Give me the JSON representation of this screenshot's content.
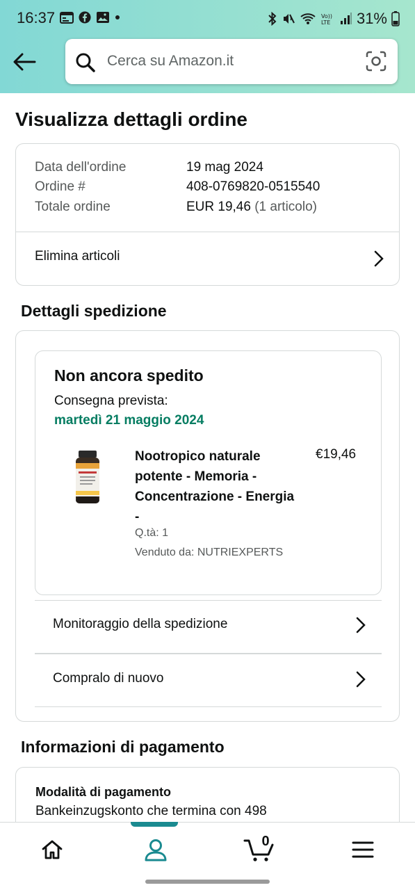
{
  "status_bar": {
    "time": "16:37",
    "battery": "31%",
    "icons": [
      "calendar-icon",
      "facebook-icon",
      "gallery-icon",
      "dot-icon",
      "bluetooth-icon",
      "mute-icon",
      "wifi-icon",
      "volte-icon",
      "signal-icon",
      "battery-icon"
    ]
  },
  "header": {
    "search_placeholder": "Cerca su Amazon.it"
  },
  "page_title": "Visualizza dettagli ordine",
  "order_summary": {
    "date_label": "Data dell'ordine",
    "date_value": "19 mag 2024",
    "number_label": "Ordine #",
    "number_value": "408-0769820-0515540",
    "total_label": "Totale ordine",
    "total_value": "EUR 19,46",
    "total_items": "(1 articolo)",
    "delete_items": "Elimina articoli"
  },
  "shipping": {
    "section_title": "Dettagli spedizione",
    "status": "Non ancora spedito",
    "delivery_label": "Consegna prevista:",
    "delivery_date": "martedì 21 maggio 2024",
    "product": {
      "title": "Nootropico naturale potente - Memoria - Concentrazione - Energia -",
      "price": "€19,46",
      "quantity": "Q.tà: 1",
      "seller": "Venduto da: NUTRIEXPERTS"
    },
    "track_label": "Monitoraggio della spedizione",
    "buy_again_label": "Compralo di nuovo"
  },
  "payment": {
    "section_title": "Informazioni di pagamento",
    "method_label": "Modalità di pagamento",
    "method_value": "Bankeinzugskonto che termina con 498"
  },
  "bottom_nav": {
    "cart_count": "0",
    "items": [
      "home-icon",
      "account-icon",
      "cart-icon",
      "menu-icon"
    ]
  },
  "colors": {
    "header_gradient_start": "#82d8d5",
    "header_gradient_end": "#a6e6ce",
    "delivery_green": "#067d62",
    "active_tab": "#1a8a90"
  }
}
